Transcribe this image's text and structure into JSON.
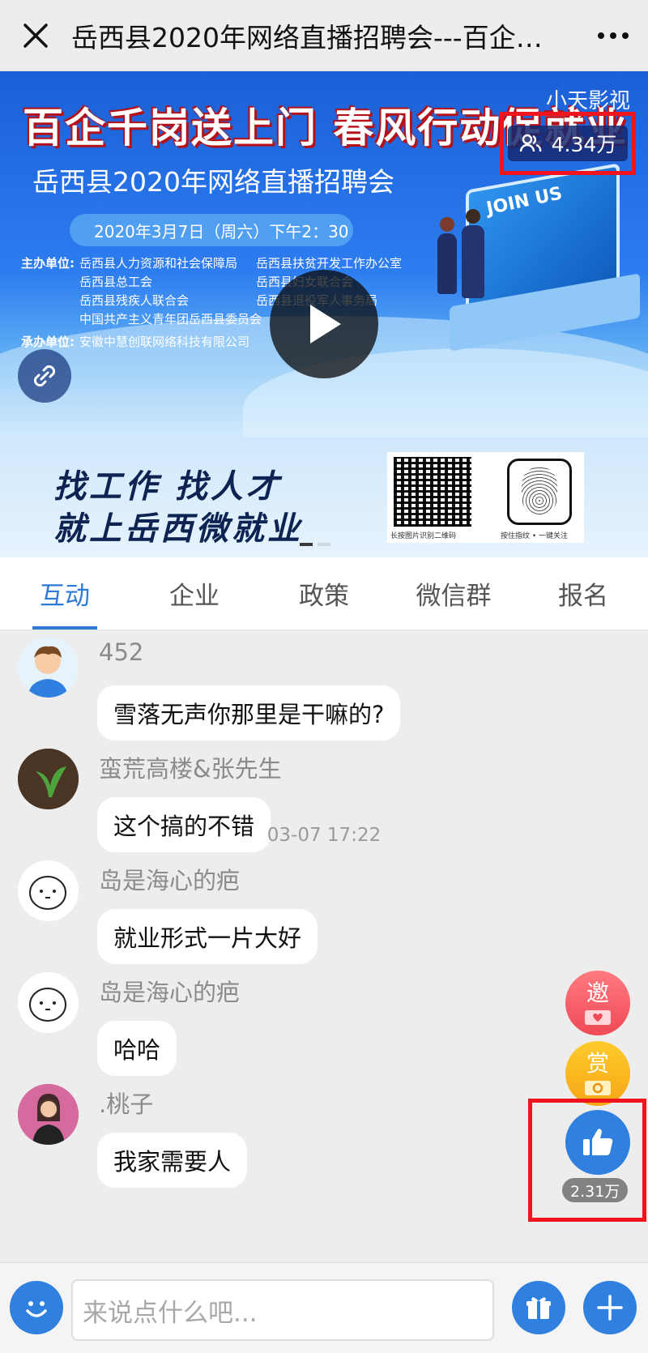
{
  "header": {
    "title": "岳西县2020年网络直播招聘会---百企千...",
    "close_icon": "close-icon",
    "more_icon": "more-icon"
  },
  "video": {
    "headline": "百企千岗送上门 春风行动促就业",
    "subtitle": "岳西县2020年网络直播招聘会",
    "date": "2020年3月7日（周六）下午2：30",
    "watermark": "小天影视",
    "viewers": "4.34万",
    "organizers": {
      "host_label": "主办单位:",
      "host_col1": [
        "岳西县人力资源和社会保障局",
        "岳西县总工会",
        "岳西县残疾人联合会",
        "中国共产主义青年团岳西县委员会"
      ],
      "host_col2": [
        "岳西县扶贫开发工作办公室",
        "岳西县妇女联合会",
        "岳西县退役军人事务局"
      ],
      "undertaker_label": "承办单位:",
      "undertaker": "安徽中慧创联网络科技有限公司"
    },
    "join_text": "JOIN US"
  },
  "ad": {
    "line1": "找工作  找人才",
    "line2": "就上岳西微就业",
    "qr_caption": "长按图片识别二维码",
    "finger_caption": "按住指纹 • 一键关注"
  },
  "tabs": [
    {
      "label": "互动",
      "active": true
    },
    {
      "label": "企业",
      "active": false
    },
    {
      "label": "政策",
      "active": false
    },
    {
      "label": "微信群",
      "active": false
    },
    {
      "label": "报名",
      "active": false
    }
  ],
  "messages": [
    {
      "user": "452",
      "text": "雪落无声你那里是干嘛的?"
    },
    {
      "user": "蛮荒高楼&张先生",
      "text": "这个搞的不错"
    },
    {
      "user": "岛是海心的疤",
      "text": "就业形式一片大好"
    },
    {
      "user": "岛是海心的疤",
      "text": "哈哈"
    },
    {
      "user": ".桃子",
      "text": "我家需要人"
    }
  ],
  "timestamp": "03-07 17:22",
  "floating": {
    "invite_label": "邀",
    "reward_label": "赏",
    "like_count": "2.31万"
  },
  "input": {
    "placeholder": "来说点什么吧..."
  },
  "colors": {
    "accent": "#2e7ad7",
    "highlight_border": "#f0151c"
  }
}
